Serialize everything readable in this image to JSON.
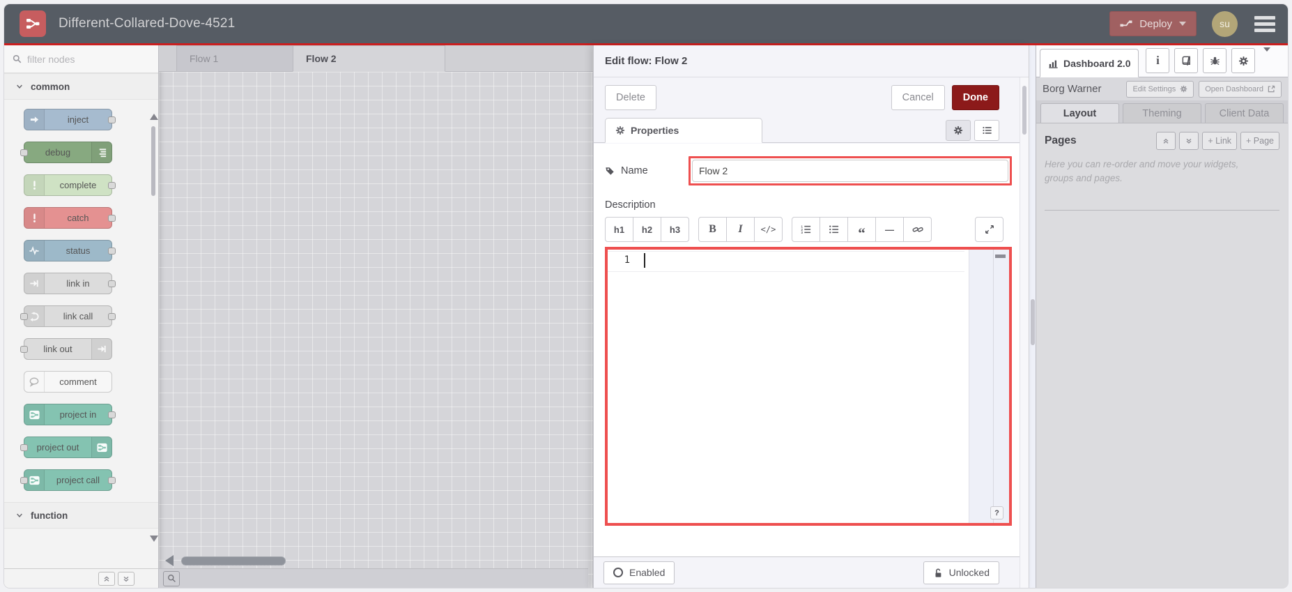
{
  "colors": {
    "header_bg": "#565c64",
    "accent_red": "#cb1f1f",
    "deploy_red": "#a06061",
    "done_red": "#8c1a1a",
    "highlight_red": "#ee4f4f",
    "logo_red": "#c75d5f",
    "avatar_bg": "#b3a678"
  },
  "header": {
    "title": "Different-Collared-Dove-4521",
    "deploy_label": "Deploy",
    "avatar": "su"
  },
  "palette": {
    "filter_placeholder": "filter nodes",
    "categories": [
      {
        "label": "common"
      },
      {
        "label": "function"
      }
    ],
    "nodes": [
      {
        "label": "inject",
        "color": "#a6bbcf",
        "icon": "inject-arrow-icon",
        "iconSide": "left",
        "hasInput": false,
        "hasOutput": true
      },
      {
        "label": "debug",
        "color": "#87a980",
        "icon": "debug-list-icon",
        "iconSide": "right",
        "hasInput": true,
        "hasOutput": false
      },
      {
        "label": "complete",
        "color": "#cfe2c4",
        "icon": "exclamation-icon",
        "iconSide": "left",
        "hasInput": false,
        "hasOutput": true
      },
      {
        "label": "catch",
        "color": "#e49191",
        "icon": "exclamation-icon",
        "iconSide": "left",
        "hasInput": false,
        "hasOutput": true
      },
      {
        "label": "status",
        "color": "#9db9c9",
        "icon": "pulse-icon",
        "iconSide": "left",
        "hasInput": false,
        "hasOutput": true
      },
      {
        "label": "link in",
        "color": "#dcdcdc",
        "icon": "link-arrow-icon",
        "iconSide": "left",
        "hasInput": false,
        "hasOutput": true
      },
      {
        "label": "link call",
        "color": "#dcdcdc",
        "icon": "link-call-icon",
        "iconSide": "left",
        "hasInput": true,
        "hasOutput": true
      },
      {
        "label": "link out",
        "color": "#dcdcdc",
        "icon": "link-arrow-icon",
        "iconSide": "right",
        "hasInput": true,
        "hasOutput": false
      },
      {
        "label": "comment",
        "color": "#f7f7f7",
        "icon": "comment-icon",
        "iconSide": "left",
        "hasInput": false,
        "hasOutput": false
      },
      {
        "label": "project in",
        "color": "#84c3b1",
        "icon": "node-red-icon",
        "iconSide": "left",
        "hasInput": false,
        "hasOutput": true
      },
      {
        "label": "project out",
        "color": "#84c3b1",
        "icon": "node-red-icon",
        "iconSide": "right",
        "hasInput": true,
        "hasOutput": false
      },
      {
        "label": "project call",
        "color": "#84c3b1",
        "icon": "node-red-icon",
        "iconSide": "left",
        "hasInput": true,
        "hasOutput": true
      }
    ]
  },
  "workspace": {
    "tabs": [
      {
        "label": "Flow 1"
      },
      {
        "label": "Flow 2"
      }
    ]
  },
  "tray": {
    "title": "Edit flow: Flow 2",
    "delete_label": "Delete",
    "cancel_label": "Cancel",
    "done_label": "Done",
    "properties_tab": "Properties",
    "name_label": "Name",
    "name_value": "Flow 2",
    "description_label": "Description",
    "md": {
      "h1": "h1",
      "h2": "h2",
      "h3": "h3",
      "bold": "B",
      "italic": "I",
      "code": "</>",
      "quote": "“",
      "hr": "—"
    },
    "editor": {
      "line_number": "1"
    },
    "help_label": "?",
    "enabled_label": "Enabled",
    "unlocked_label": "Unlocked"
  },
  "sidebar": {
    "tab_label": "Dashboard 2.0",
    "owner": "Borg Warner",
    "edit_settings_label": "Edit Settings",
    "open_dashboard_label": "Open Dashboard",
    "tabs": [
      {
        "label": "Layout"
      },
      {
        "label": "Theming"
      },
      {
        "label": "Client Data"
      }
    ],
    "pages_title": "Pages",
    "link_button": "+ Link",
    "page_button": "+ Page",
    "pages_help": "Here you can re-order and move your widgets, groups and pages."
  }
}
